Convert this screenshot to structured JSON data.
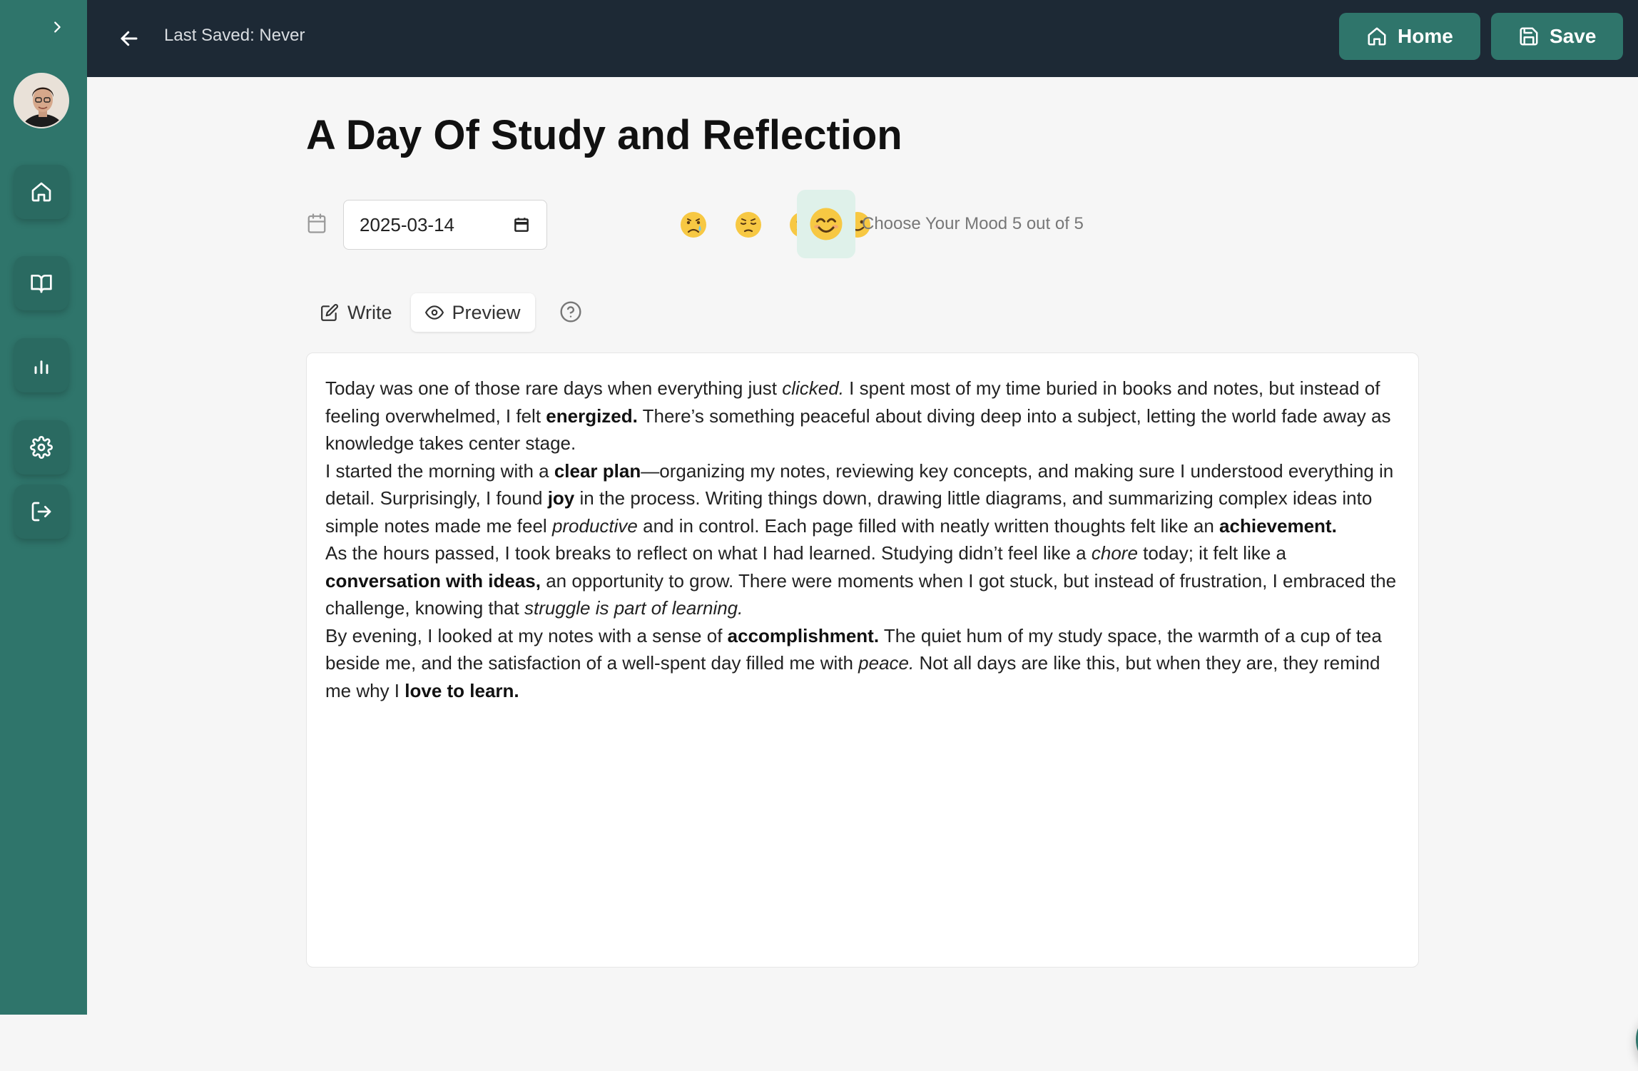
{
  "header": {
    "last_saved": "Last Saved: Never",
    "home_label": "Home",
    "save_label": "Save"
  },
  "sidebar": {
    "items": [
      {
        "icon": "home-icon"
      },
      {
        "icon": "book-icon"
      },
      {
        "icon": "chart-icon"
      },
      {
        "icon": "gear-icon"
      },
      {
        "icon": "logout-icon"
      }
    ]
  },
  "entry": {
    "title": "A Day Of Study and Reflection",
    "date": "2025-03-14",
    "mood_label": "Choose Your Mood 5 out of 5",
    "mood_selected": 5,
    "moods": [
      "😢",
      "😔",
      "😐",
      "🙂",
      "😊"
    ]
  },
  "tabs": {
    "write": "Write",
    "preview": "Preview"
  },
  "content": {
    "p1": [
      "Today was one of those rare days when everything just ",
      "clicked.",
      " I spent most of my time buried in books and notes, but instead of feeling overwhelmed, I felt ",
      "energized.",
      " There’s something peaceful about diving deep into a subject, letting the world fade away as knowledge takes center stage."
    ],
    "p2": [
      "I started the morning with a ",
      "clear plan",
      "—organizing my notes, reviewing key concepts, and making sure I understood everything in detail. Surprisingly, I found ",
      "joy",
      " in the process. Writing things down, drawing little diagrams, and summarizing complex ideas into simple notes made me feel ",
      "productive",
      " and in control. Each page filled with neatly written thoughts felt like an ",
      "achievement."
    ],
    "p3": [
      "As the hours passed, I took breaks to reflect on what I had learned. Studying didn’t feel like a ",
      "chore",
      " today; it felt like a ",
      "conversation with ideas,",
      " an opportunity to grow. There were moments when I got stuck, but instead of frustration, I embraced the challenge, knowing that ",
      "struggle is part of learning."
    ],
    "p4": [
      "By evening, I looked at my notes with a sense of ",
      "accomplishment.",
      " The quiet hum of my study space, the warmth of a cup of tea beside me, and the satisfaction of a well-spent day filled me with ",
      "peace.",
      " Not all days are like this, but when they are, they remind me why I ",
      "love to learn."
    ]
  },
  "colors": {
    "sidebar": "#2f756b",
    "topbar": "#1d2935",
    "accent": "#2f756b",
    "mood_selected_bg": "#dff1ea"
  }
}
